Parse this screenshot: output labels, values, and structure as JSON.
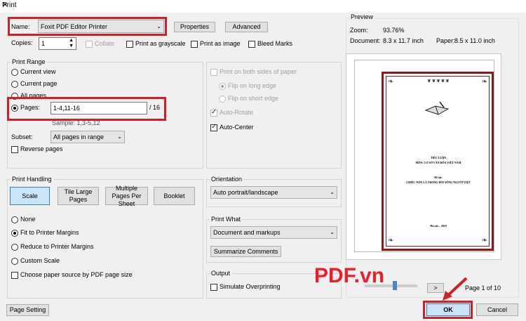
{
  "window": {
    "title": "Print"
  },
  "printer": {
    "label": "Name:",
    "value": "Foxit PDF Editor Printer",
    "properties": "Properties",
    "advanced": "Advanced"
  },
  "copies": {
    "label": "Copies:",
    "value": "1",
    "collate": "Collate",
    "grayscale": "Print as grayscale",
    "as_image": "Print as image",
    "bleed": "Bleed Marks"
  },
  "print_range": {
    "title": "Print Range",
    "current_view": "Current view",
    "current_page": "Current page",
    "all_pages": "All pages",
    "pages_label": "Pages:",
    "pages_value": "1-4,11-16",
    "pages_total": "/ 16",
    "sample": "Sample: 1,3-5,12",
    "subset_label": "Subset:",
    "subset_value": "All pages in range",
    "reverse": "Reverse pages"
  },
  "duplex": {
    "both_sides": "Print on both sides of paper",
    "long_edge": "Flip on long edge",
    "short_edge": "Flip on short edge",
    "auto_rotate": "Auto-Rotate",
    "auto_center": "Auto-Center"
  },
  "handling": {
    "title": "Print Handling",
    "scale": "Scale",
    "tile": "Tile Large Pages",
    "multiple": "Multiple Pages Per Sheet",
    "booklet": "Booklet",
    "none": "None",
    "fit": "Fit to Printer Margins",
    "reduce": "Reduce to Printer Margins",
    "custom": "Custom Scale",
    "paper_source": "Choose paper source by PDF page size"
  },
  "orientation": {
    "title": "Orientation",
    "value": "Auto portrait/landscape"
  },
  "print_what": {
    "title": "Print What",
    "value": "Document and markups",
    "summarize": "Summarize Comments"
  },
  "output": {
    "title": "Output",
    "simulate": "Simulate Overprinting"
  },
  "preview": {
    "title": "Preview",
    "zoom_label": "Zoom:",
    "zoom_value": "93.76%",
    "document_label": "Document:",
    "document_value": "8.3 x 11.7 inch",
    "paper_label": "Paper:",
    "paper_value": "8.5 x 11.0 inch",
    "page_indicator": "Page 1 of 10",
    "doc_lines": [
      "TIỂU LUẬN",
      "MÔN: CƠ SỞ VĂN HÓA VIỆT NAM",
      "Đề tài:",
      "CHIẾC NÓN LÁ TRONG ĐỜI SỐNG NGƯỜI VIỆT",
      "Hà nội – 2010"
    ]
  },
  "footer": {
    "page_setup": "Page Setting",
    "ok": "OK",
    "cancel": "Cancel"
  },
  "watermark": "PDF.vn",
  "colors": {
    "highlight": "#d0202a",
    "accent_button": "#cce4f7",
    "frame": "#8a1a1a"
  }
}
